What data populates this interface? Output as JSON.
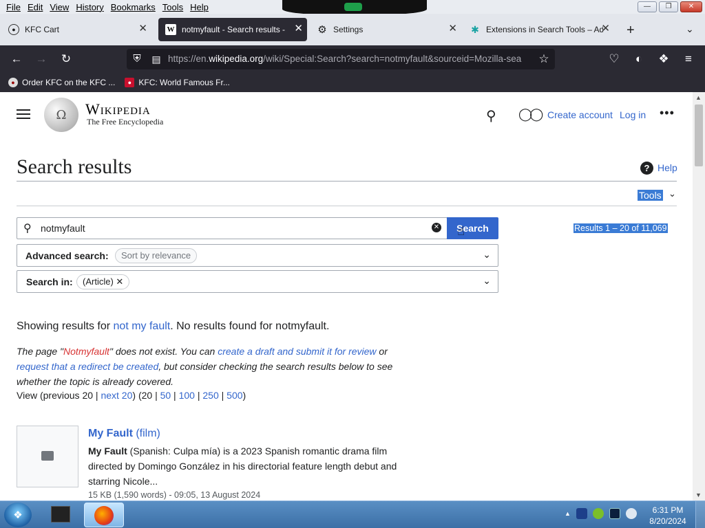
{
  "menubar": {
    "items": [
      "File",
      "Edit",
      "View",
      "History",
      "Bookmarks",
      "Tools",
      "Help"
    ]
  },
  "tabs": [
    {
      "title": "KFC Cart",
      "icon": "kfc-icon"
    },
    {
      "title": "notmyfault - Search results - W",
      "icon": "wikipedia-icon"
    },
    {
      "title": "Settings",
      "icon": "gear-icon"
    },
    {
      "title": "Extensions in Search Tools – Ad",
      "icon": "puzzle-icon"
    }
  ],
  "url": {
    "prefix": "https://en.",
    "domain": "wikipedia.org",
    "suffix": "/wiki/Special:Search?search=notmyfault&sourceid=Mozilla-sea"
  },
  "bookmarks": [
    {
      "label": "Order KFC on the KFC ..."
    },
    {
      "label": "KFC: World Famous Fr..."
    }
  ],
  "wiki": {
    "wordmark": "Wikipedia",
    "tagline": "The Free Encyclopedia",
    "create_account": "Create account",
    "log_in": "Log in",
    "page_title": "Search results",
    "help": "Help",
    "tools": "Tools"
  },
  "search": {
    "value": "notmyfault",
    "button": "Search",
    "results_summary": "Results 1 – 20 of 11,069",
    "advanced_label": "Advanced search:",
    "sort_chip": "Sort by relevance",
    "searchin_label": "Search in:",
    "article_chip": "(Article)"
  },
  "showing": {
    "prefix": "Showing results for ",
    "suggest_link": "not my fault",
    "suffix": ". No results found for notmyfault."
  },
  "note": {
    "p1": "The page \"",
    "redlink": "Notmyfault",
    "p2": "\" does not exist. You can ",
    "link1": "create a draft and submit it for review",
    "p3": " or ",
    "link2": "request that a redirect be created",
    "p4": ", but consider checking the search results below to see whether the topic is already covered."
  },
  "paging": {
    "prefix": "View (previous 20 | ",
    "next": "next 20",
    "mid": ") (20 | ",
    "n50": "50",
    "n100": "100",
    "n250": "250",
    "n500": "500",
    "end": ")",
    "sep": " | "
  },
  "results": [
    {
      "title": "My Fault",
      "qualifier": "(film)",
      "snippet_bold": "My Fault",
      "snippet": " (Spanish: Culpa mía) is a 2023 Spanish romantic drama film directed by Domingo González in his directorial feature length debut and starring Nicole...",
      "meta": "15 KB (1,590 words) - 09:05, 13 August 2024"
    }
  ],
  "taskbar": {
    "time": "6:31 PM",
    "date": "8/20/2024"
  }
}
